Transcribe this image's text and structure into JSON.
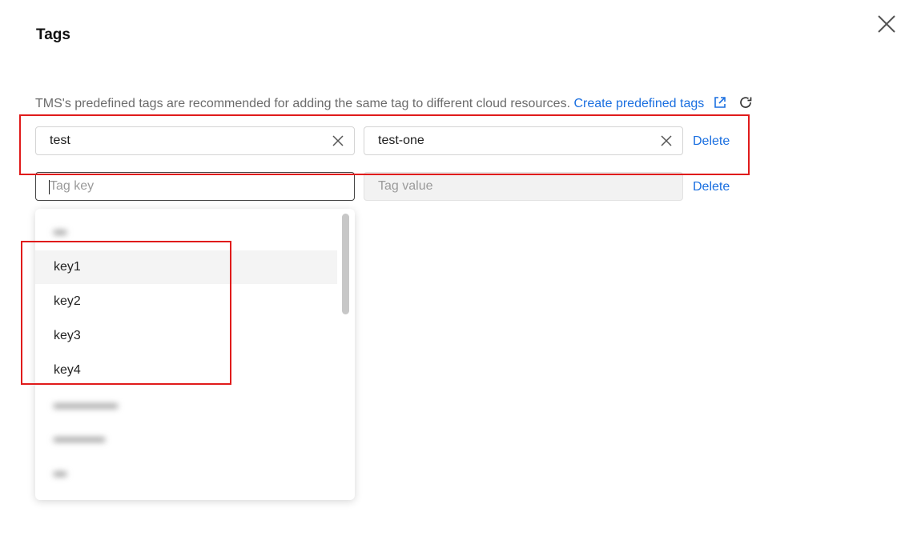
{
  "dialog": {
    "title": "Tags"
  },
  "hint": {
    "text": "TMS's predefined tags are recommended for adding the same tag to different cloud resources.",
    "link_label": "Create predefined tags",
    "external_icon": "external-link-icon",
    "refresh_icon": "refresh-icon"
  },
  "rows": [
    {
      "key": "test",
      "value": "test-one",
      "delete_label": "Delete"
    },
    {
      "key": "",
      "key_placeholder": "Tag key",
      "value_placeholder": "Tag value",
      "delete_label": "Delete"
    }
  ],
  "dropdown": {
    "options": [
      "key1",
      "key2",
      "key3",
      "key4"
    ]
  },
  "colors": {
    "link": "#1a6fe0",
    "highlight": "#e01b1b"
  }
}
